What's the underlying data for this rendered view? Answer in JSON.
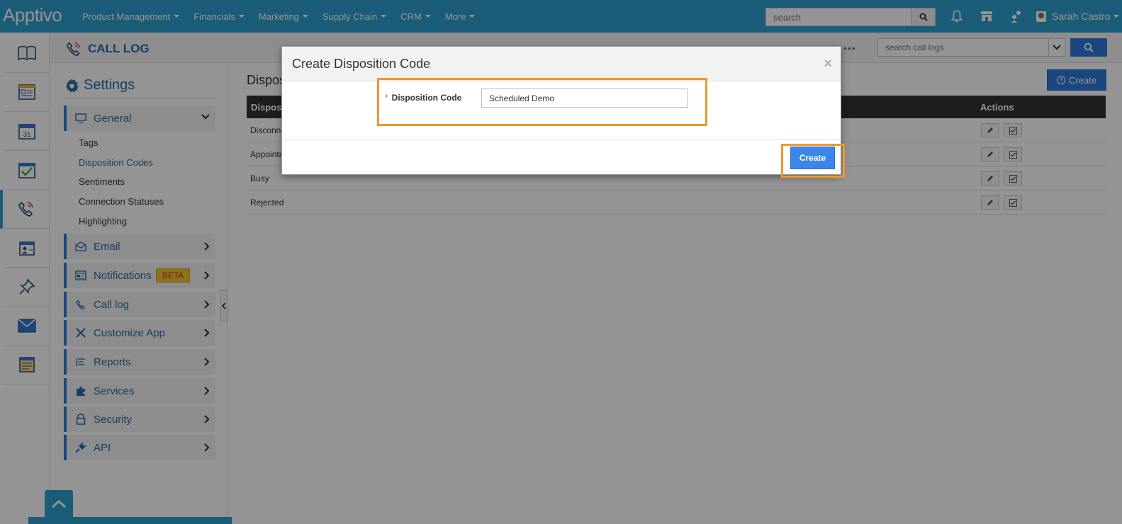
{
  "brand": {
    "logo": "Apptivo"
  },
  "topnav": {
    "items": [
      "Product Management",
      "Financials",
      "Marketing",
      "Supply Chain",
      "CRM",
      "More"
    ],
    "search_placeholder": "search",
    "user_name": "Sarah Castro"
  },
  "rail_icons": [
    "book-icon",
    "form-icon",
    "calendar-icon",
    "checklist-icon",
    "call-log-icon",
    "contact-card-icon",
    "pin-icon",
    "envelope-icon",
    "notes-icon"
  ],
  "app": {
    "title": "CALL LOG",
    "search_placeholder": "search call logs",
    "more_dots": "•••"
  },
  "settings": {
    "title": "Settings",
    "general_label": "General",
    "general_subitems": [
      "Tags",
      "Disposition Codes",
      "Sentiments",
      "Connection Statuses",
      "Highlighting"
    ],
    "active_subitem": "Disposition Codes",
    "menu": [
      {
        "label": "Email",
        "icon": "email-icon"
      },
      {
        "label": "Notifications",
        "icon": "notifications-icon",
        "badge": "BETA"
      },
      {
        "label": "Call log",
        "icon": "phone-icon"
      },
      {
        "label": "Customize App",
        "icon": "tools-icon"
      },
      {
        "label": "Reports",
        "icon": "reports-icon"
      },
      {
        "label": "Services",
        "icon": "puzzle-icon"
      },
      {
        "label": "Security",
        "icon": "lock-icon"
      },
      {
        "label": "API",
        "icon": "plug-icon"
      }
    ]
  },
  "content": {
    "title": "Dispos",
    "create_label": "Create",
    "table": {
      "columns": [
        "Disposit",
        "Actions"
      ],
      "rows": [
        "Disconn",
        "Appointm",
        "Busy",
        "Rejected"
      ]
    }
  },
  "modal": {
    "title": "Create Disposition Code",
    "close": "×",
    "required_mark": "*",
    "field_label": "Disposition Code",
    "field_value": "Scheduled Demo",
    "submit_label": "Create"
  },
  "colors": {
    "topbar": "#2f9fd0",
    "accent": "#2f7bdc",
    "highlight": "#f0962e",
    "beta_bg": "#f4c430",
    "beta_text": "#c0392b"
  }
}
